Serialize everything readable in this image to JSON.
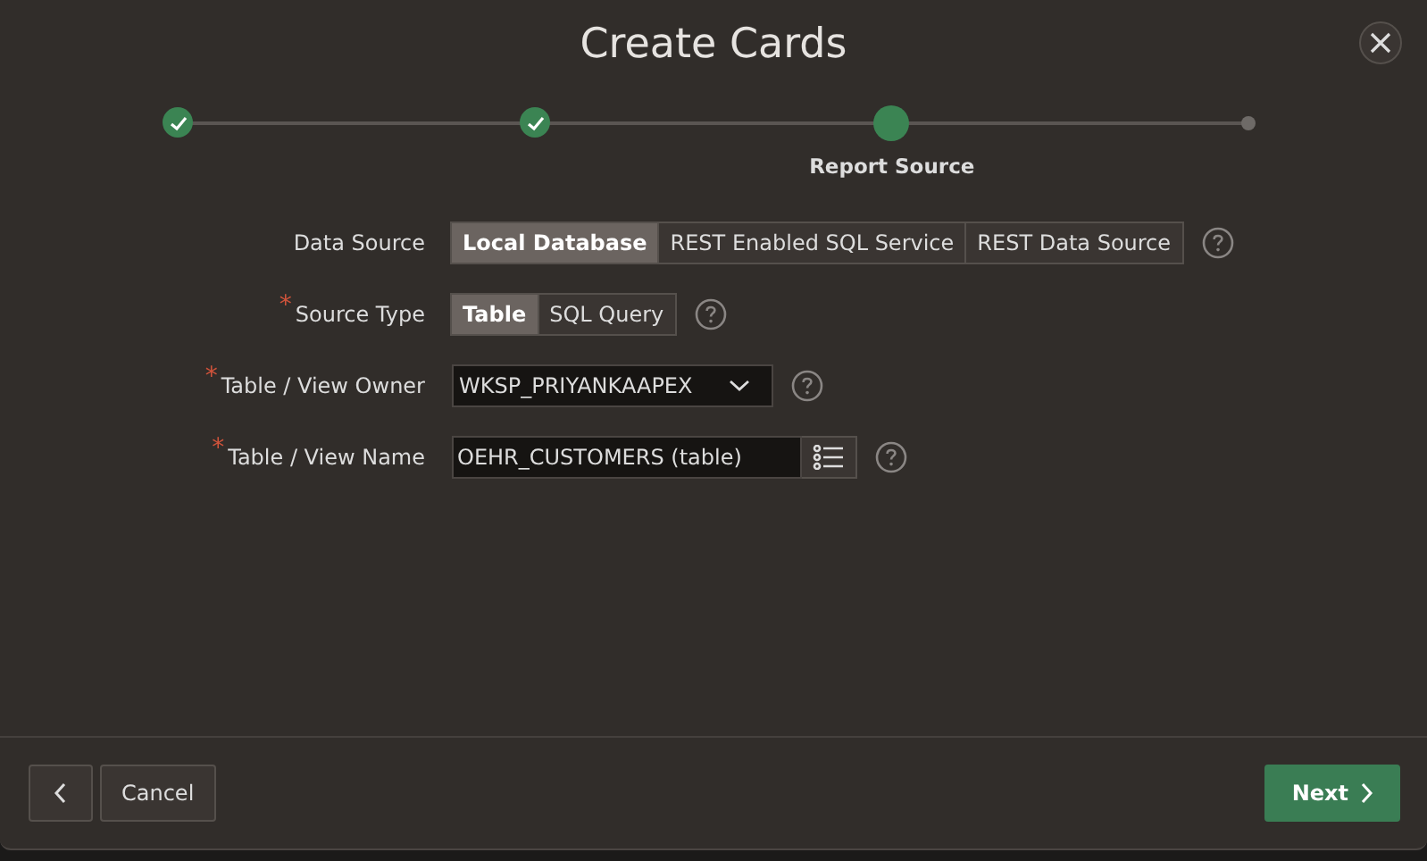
{
  "dialog": {
    "title": "Create Cards"
  },
  "steps": [
    {
      "kind": "done"
    },
    {
      "kind": "done"
    },
    {
      "kind": "current",
      "label": "Report Source"
    },
    {
      "kind": "todo"
    }
  ],
  "fields": [
    {
      "kind": "segmented",
      "label": "Data Source",
      "options": [
        {
          "label": "Local Database",
          "selected": true
        },
        {
          "label": "REST Enabled SQL Service",
          "selected": false
        },
        {
          "label": "REST Data Source",
          "selected": false
        }
      ]
    },
    {
      "kind": "segmented",
      "label": "Source Type",
      "required_mark": "*",
      "options": [
        {
          "label": "Table",
          "selected": true
        },
        {
          "label": "SQL Query",
          "selected": false
        }
      ]
    },
    {
      "kind": "select",
      "label": "Table / View Owner",
      "required_mark": "*",
      "value": "WKSP_PRIYANKAAPEX"
    },
    {
      "kind": "popup",
      "label": "Table / View Name",
      "required_mark": "*",
      "value": "OEHR_CUSTOMERS (table)"
    }
  ],
  "footer": {
    "cancel": "Cancel",
    "next": "Next"
  }
}
